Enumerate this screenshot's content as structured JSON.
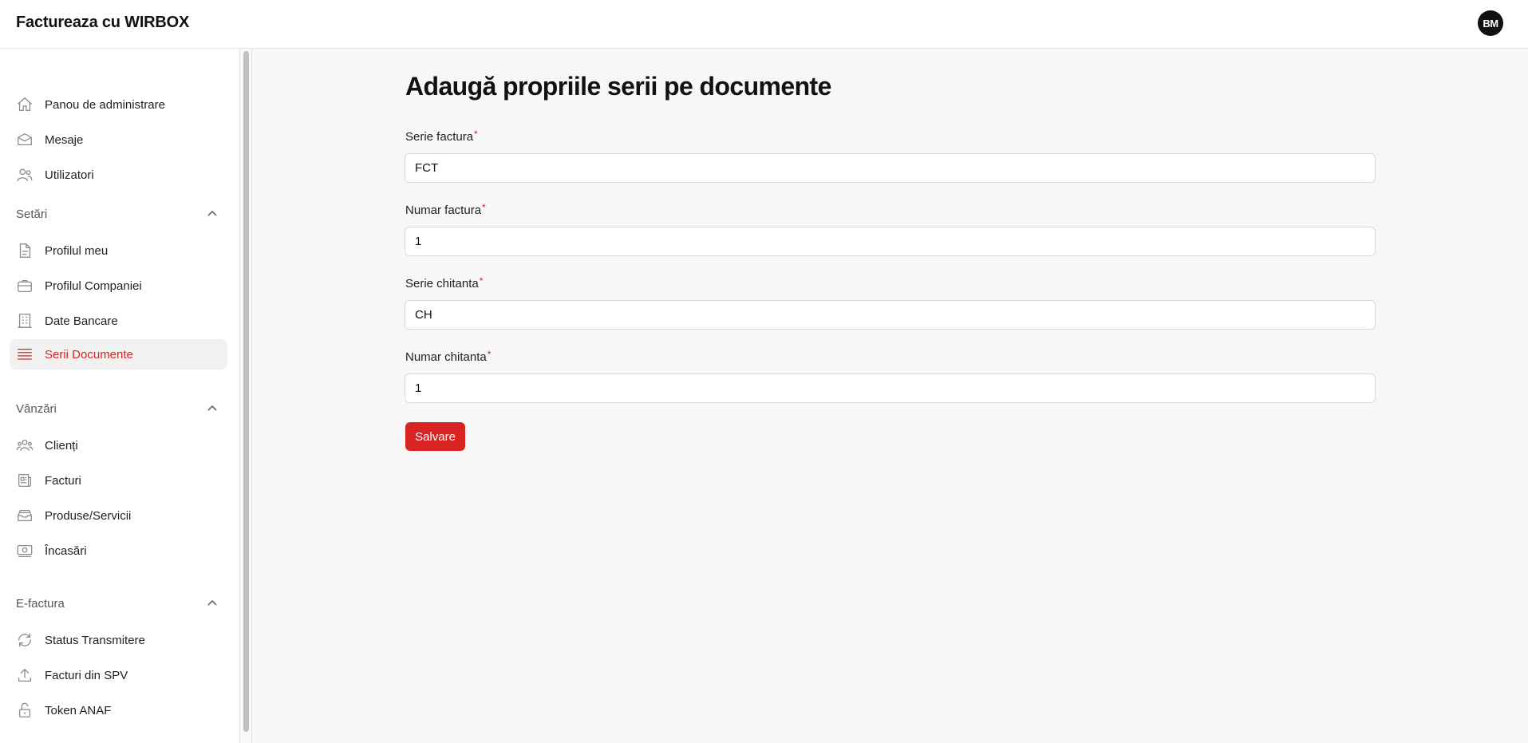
{
  "header": {
    "app_title": "Factureaza cu WIRBOX",
    "avatar_initials": "BM"
  },
  "sidebar": {
    "top_items": [
      {
        "label": "Panou de administrare",
        "icon": "home-icon"
      },
      {
        "label": "Mesaje",
        "icon": "mail-icon"
      },
      {
        "label": "Utilizatori",
        "icon": "users-icon"
      }
    ],
    "sections": [
      {
        "title": "Setări",
        "items": [
          {
            "label": "Profilul meu",
            "icon": "document-icon"
          },
          {
            "label": "Profilul Companiei",
            "icon": "briefcase-icon"
          },
          {
            "label": "Date Bancare",
            "icon": "building-icon"
          },
          {
            "label": "Serii Documente",
            "icon": "list-icon",
            "active": true
          }
        ]
      },
      {
        "title": "Vânzări",
        "items": [
          {
            "label": "Clienți",
            "icon": "user-group-icon"
          },
          {
            "label": "Facturi",
            "icon": "newspaper-icon"
          },
          {
            "label": "Produse/Servicii",
            "icon": "inbox-stack-icon"
          },
          {
            "label": "Încasări",
            "icon": "banknotes-icon"
          }
        ]
      },
      {
        "title": "E-factura",
        "items": [
          {
            "label": "Status Transmitere",
            "icon": "refresh-icon"
          },
          {
            "label": "Facturi din SPV",
            "icon": "upload-icon"
          },
          {
            "label": "Token ANAF",
            "icon": "lock-open-icon"
          }
        ]
      }
    ]
  },
  "main": {
    "title": "Adaugă propriile serii pe documente",
    "fields": [
      {
        "label": "Serie factura",
        "required_mark": "*",
        "value": "FCT"
      },
      {
        "label": "Numar factura",
        "required_mark": "*",
        "value": "1"
      },
      {
        "label": "Serie chitanta",
        "required_mark": "*",
        "value": "CH"
      },
      {
        "label": "Numar chitanta",
        "required_mark": "*",
        "value": "1"
      }
    ],
    "save_label": "Salvare"
  },
  "colors": {
    "accent": "#d92323",
    "background": "#f7f7f7"
  }
}
